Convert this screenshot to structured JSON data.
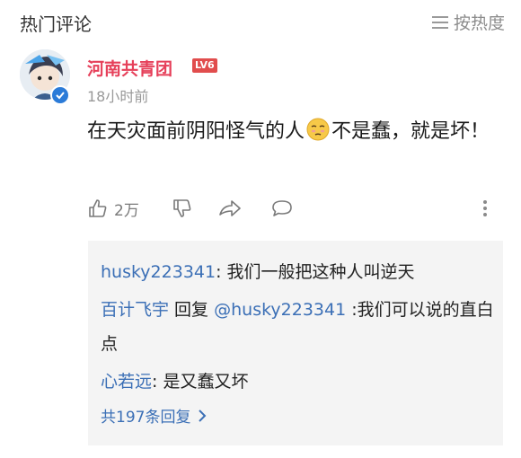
{
  "header": {
    "title": "热门评论",
    "sort_label": "按热度",
    "sort_icon": "list-sort-icon"
  },
  "comment": {
    "username": "河南共青团",
    "level": "LV6",
    "timestamp": "18小时前",
    "text_part1": "在天灾面前阴阳怪气的人",
    "emoji": "unamused-face-emoji",
    "text_part2": "不是蠢，就是坏！",
    "likes": "2万",
    "colors": {
      "username": "#e6405a",
      "link": "#3b6fb6",
      "level_badge": "#e14d4d"
    }
  },
  "replies": [
    {
      "author": "husky223341",
      "separator": ": ",
      "text": "我们一般把这种人叫逆天"
    },
    {
      "author": "百计飞宇",
      "reply_word": " 回复 ",
      "mention": "@husky223341",
      "separator": " :",
      "text": "我们可以说的直白点"
    },
    {
      "author": "心若远",
      "separator": ": ",
      "text": "是又蠢又坏"
    }
  ],
  "more_replies_label": "共197条回复"
}
